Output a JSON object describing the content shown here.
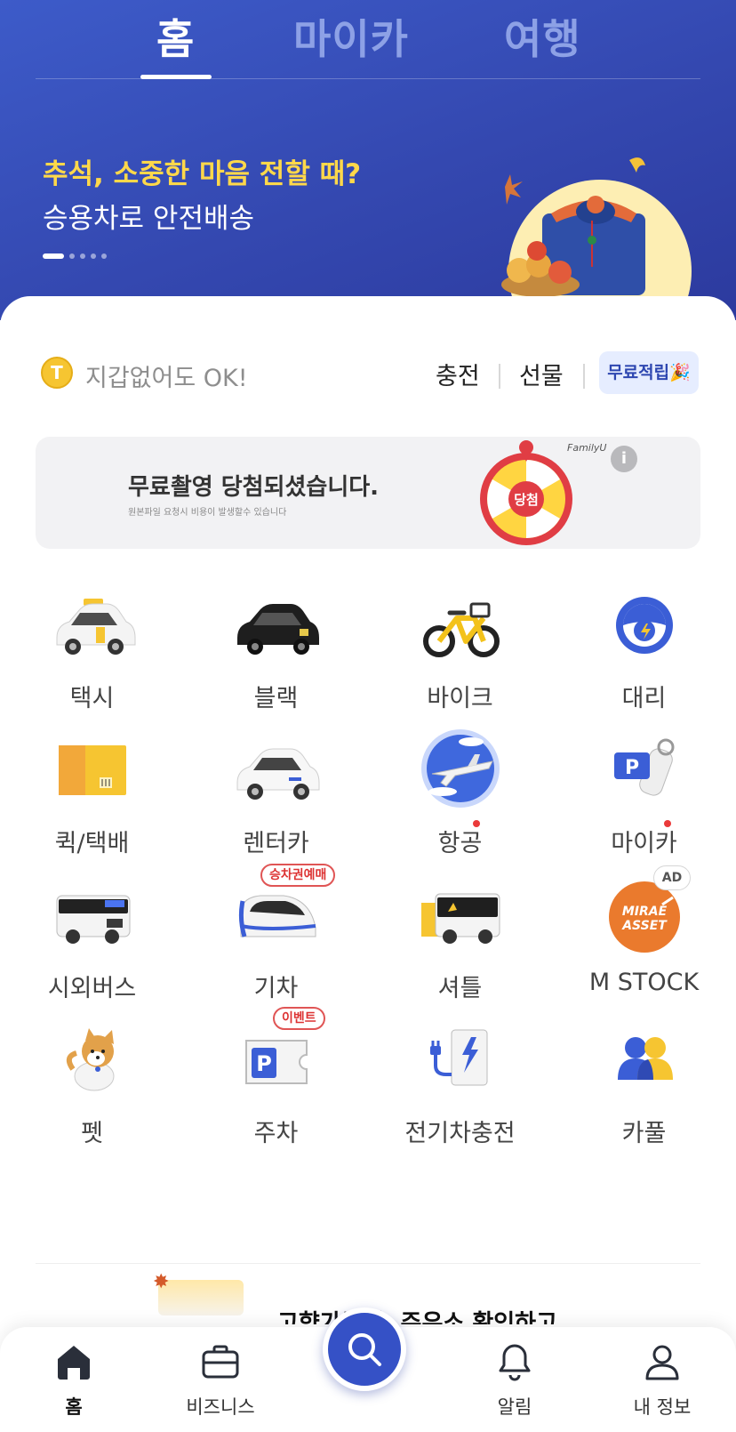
{
  "top_tabs": [
    {
      "label": "홈",
      "active": true
    },
    {
      "label": "마이카",
      "active": false
    },
    {
      "label": "여행",
      "active": false
    }
  ],
  "banner": {
    "title": "추석, 소중한 마음 전할 때?",
    "subtitle": "승용차로 안전배송",
    "page_count": 5,
    "current_page": 1
  },
  "wallet": {
    "coin_letter": "T",
    "text": "지갑없어도 OK!",
    "charge_label": "충전",
    "gift_label": "선물",
    "free_label": "무료적립🎉"
  },
  "ad_card": {
    "title": "무료촬영 당첨되셨습니다.",
    "small_text": "원본파일 요청시 비용이 발생할수 있습니다",
    "wheel_label": "당첨",
    "brand": "FamilyU",
    "info_icon": "i"
  },
  "services": [
    {
      "label": "택시",
      "icon": "taxi-icon"
    },
    {
      "label": "블랙",
      "icon": "black-car-icon"
    },
    {
      "label": "바이크",
      "icon": "bike-icon"
    },
    {
      "label": "대리",
      "icon": "steering-wheel-icon"
    },
    {
      "label": "퀵/택배",
      "icon": "parcel-box-icon"
    },
    {
      "label": "렌터카",
      "icon": "rental-car-icon"
    },
    {
      "label": "항공",
      "icon": "airplane-globe-icon",
      "new_dot": true
    },
    {
      "label": "마이카",
      "icon": "parking-key-icon",
      "new_dot": true
    },
    {
      "label": "시외버스",
      "icon": "bus-icon"
    },
    {
      "label": "기차",
      "icon": "train-icon",
      "badge": "승차권예매"
    },
    {
      "label": "셔틀",
      "icon": "shuttle-icon"
    },
    {
      "label": "M STOCK",
      "icon": "mirae-asset-logo",
      "logo_text": "MIRAE ASSET",
      "ad_tag": "AD"
    },
    {
      "label": "펫",
      "icon": "dog-icon"
    },
    {
      "label": "주차",
      "icon": "parking-ticket-icon",
      "badge": "이벤트"
    },
    {
      "label": "전기차충전",
      "icon": "ev-charger-icon"
    },
    {
      "label": "카풀",
      "icon": "carpool-people-icon"
    }
  ],
  "promo": {
    "text": "고향가는길, 주유소 확인하고"
  },
  "bottom_nav": [
    {
      "label": "홈",
      "icon": "home-icon",
      "active": true
    },
    {
      "label": "비즈니스",
      "icon": "briefcase-icon",
      "active": false
    },
    {
      "label": "",
      "icon": "search-icon",
      "active": false
    },
    {
      "label": "알림",
      "icon": "bell-icon",
      "active": false
    },
    {
      "label": "내 정보",
      "icon": "person-icon",
      "active": false
    }
  ],
  "colors": {
    "header_blue": "#3448b0",
    "banner_yellow": "#ffd84a",
    "accent_blue": "#3551c6",
    "badge_red": "#e05555"
  }
}
